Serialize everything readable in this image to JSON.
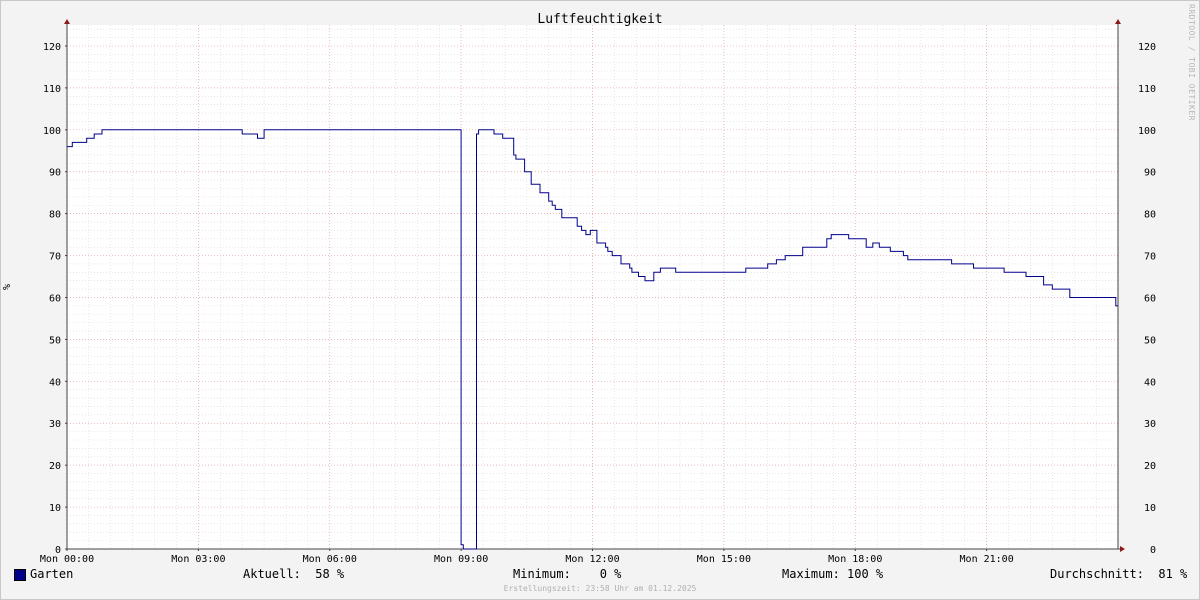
{
  "chart_data": {
    "type": "line",
    "title": "Luftfeuchtigkeit",
    "ylabel": "%",
    "xlabel": "",
    "ylim": [
      0,
      125
    ],
    "xlim_hours": [
      0,
      24
    ],
    "y_ticks": [
      0,
      10,
      20,
      30,
      40,
      50,
      60,
      70,
      80,
      90,
      100,
      110,
      120
    ],
    "x_ticks": [
      {
        "hour": 0,
        "label": "Mon 00:00"
      },
      {
        "hour": 3,
        "label": "Mon 03:00"
      },
      {
        "hour": 6,
        "label": "Mon 06:00"
      },
      {
        "hour": 9,
        "label": "Mon 09:00"
      },
      {
        "hour": 12,
        "label": "Mon 12:00"
      },
      {
        "hour": 15,
        "label": "Mon 15:00"
      },
      {
        "hour": 18,
        "label": "Mon 18:00"
      },
      {
        "hour": 21,
        "label": "Mon 21:00"
      }
    ],
    "grid": true,
    "series": [
      {
        "name": "Garten",
        "color": "#00008b",
        "x_hours": [
          0,
          0.12,
          0.45,
          0.62,
          0.8,
          3.7,
          4.0,
          4.35,
          4.5,
          8.95,
          9.0,
          9.05,
          9.3,
          9.35,
          9.4,
          9.75,
          9.95,
          10.2,
          10.25,
          10.45,
          10.6,
          10.8,
          11.0,
          11.08,
          11.15,
          11.25,
          11.3,
          11.65,
          11.7,
          11.75,
          11.85,
          11.95,
          12.1,
          12.15,
          12.3,
          12.35,
          12.45,
          12.6,
          12.65,
          12.85,
          12.9,
          13.05,
          13.2,
          13.3,
          13.4,
          13.55,
          13.8,
          13.9,
          14.0,
          14.05,
          14.2,
          14.5,
          15.5,
          16.0,
          16.2,
          16.4,
          16.8,
          17.3,
          17.35,
          17.45,
          17.85,
          18.25,
          18.4,
          18.55,
          18.8,
          19.1,
          19.2,
          19.4,
          20.2,
          20.7,
          21.2,
          21.4,
          21.9,
          22.3,
          22.5,
          22.9,
          23.9,
          23.95,
          24.0
        ],
        "values": [
          96,
          97,
          98,
          99,
          100,
          100,
          99,
          98,
          100,
          100,
          1,
          0,
          0,
          99,
          100,
          99,
          98,
          94,
          93,
          90,
          87,
          85,
          83,
          82,
          81,
          81,
          79,
          77,
          77,
          76,
          75,
          76,
          73,
          73,
          72,
          71,
          70,
          70,
          68,
          67,
          66,
          65,
          64,
          64,
          66,
          67,
          67,
          66,
          66,
          66,
          66,
          66,
          67,
          68,
          69,
          70,
          72,
          72,
          74,
          75,
          74,
          72,
          73,
          72,
          71,
          70,
          69,
          69,
          68,
          67,
          67,
          66,
          65,
          63,
          62,
          60,
          60,
          58,
          58
        ]
      }
    ],
    "legend": {
      "placement": "bottom",
      "aktuell_label": "Aktuell:",
      "aktuell_value": "58 %",
      "minimum_label": "Minimum:",
      "minimum_value": "0 %",
      "maximum_label": "Maximum:",
      "maximum_value": "100 %",
      "durchschnitt_label": "Durchschnitt:",
      "durchschnitt_value": "81 %"
    },
    "footer": "Erstellungszeit: 23:58 Uhr am 01.12.2025",
    "watermark": "RRDTOOL / TOBI OETIKER"
  }
}
